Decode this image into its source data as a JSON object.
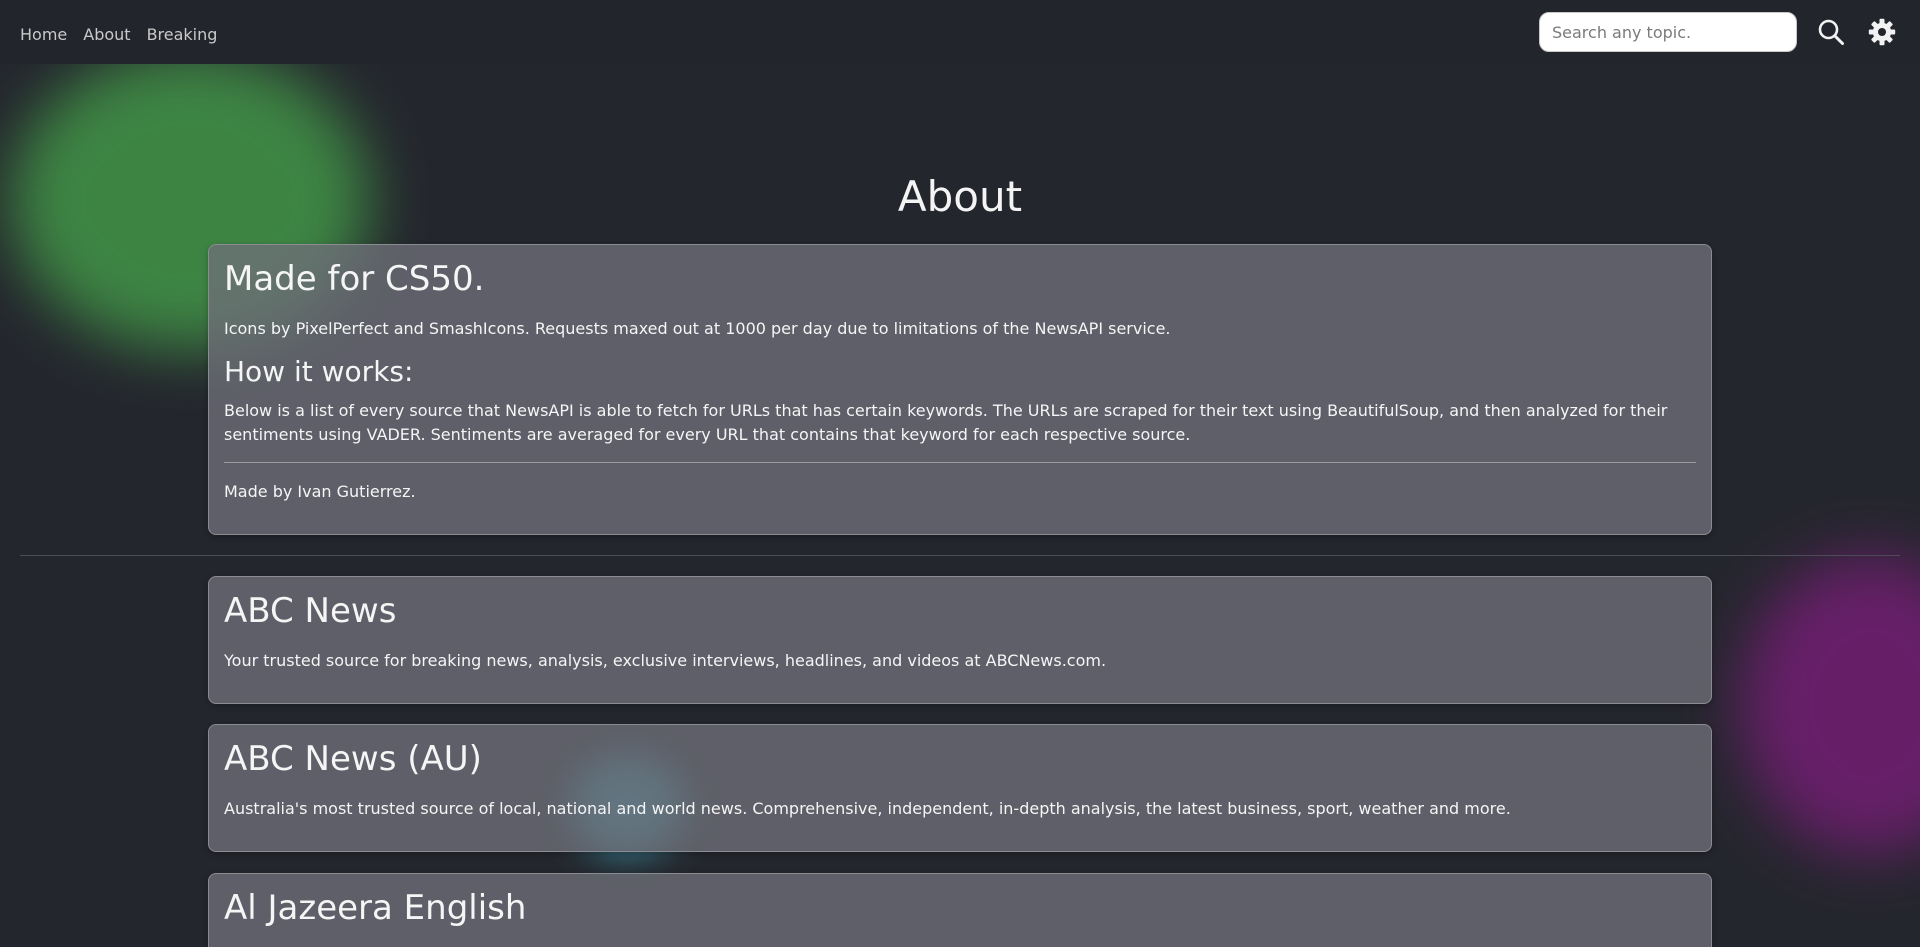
{
  "nav": {
    "links": [
      "Home",
      "About",
      "Breaking"
    ],
    "search_placeholder": "Search any topic.",
    "search_icon": "search-icon",
    "settings_icon": "gear-icon"
  },
  "page": {
    "title": "About"
  },
  "about_card": {
    "title": "Made for CS50.",
    "credits": "Icons by PixelPerfect and SmashIcons. Requests maxed out at 1000 per day due to limitations of the NewsAPI service.",
    "how_title": "How it works:",
    "how_text": "Below is a list of every source that NewsAPI is able to fetch for URLs that has certain keywords. The URLs are scraped for their text using BeautifulSoup, and then analyzed for their sentiments using VADER. Sentiments are averaged for every URL that contains that keyword for each respective source.",
    "author": "Made by Ivan Gutierrez."
  },
  "sources": [
    {
      "name": "ABC News",
      "description": "Your trusted source for breaking news, analysis, exclusive interviews, headlines, and videos at ABCNews.com."
    },
    {
      "name": "ABC News (AU)",
      "description": "Australia's most trusted source of local, national and world news. Comprehensive, independent, in-depth analysis, the latest business, sport, weather and more."
    },
    {
      "name": "Al Jazeera English",
      "description": ""
    }
  ],
  "colors": {
    "background": "#24262d",
    "navbar": "#22252b",
    "card": "#6e7078",
    "blob_green": "#3f8a45",
    "blob_purple": "#6a1f6b",
    "blob_blue": "#3a8fa3"
  }
}
